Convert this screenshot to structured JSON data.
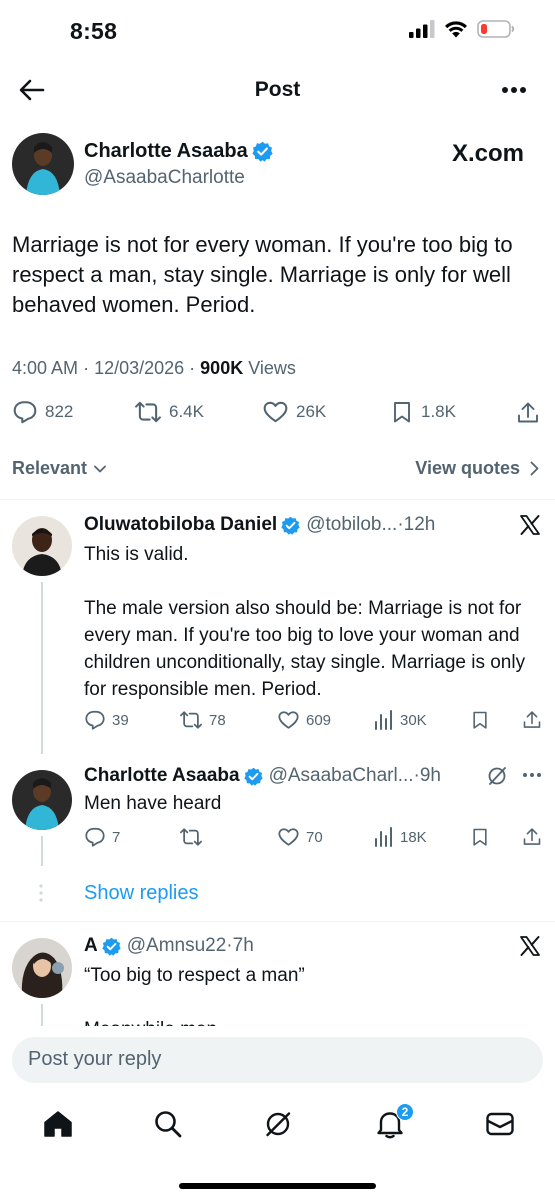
{
  "status": {
    "time": "8:58"
  },
  "nav": {
    "title": "Post"
  },
  "post": {
    "author": "Charlotte Asaaba",
    "handle": "@AsaabaCharlotte",
    "source": "X.com",
    "text": "Marriage is not for every woman. If you're too big to respect a man, stay single. Marriage is only for well behaved women. Period.",
    "time": "4:00 AM",
    "date": "12/03/2026",
    "views_count": "900K",
    "views_label": "Views",
    "replies": "822",
    "reposts": "6.4K",
    "likes": "26K",
    "bookmarks": "1.8K"
  },
  "filter": {
    "label": "Relevant",
    "view_quotes": "View quotes"
  },
  "replies": [
    {
      "author": "Oluwatobiloba Daniel",
      "handle": "@tobilob...",
      "time": "12h",
      "line1": "This is valid.",
      "line2": "The male version also should be: Marriage is not for every man. If you're too big to love your woman and children unconditionally, stay single. Marriage is only for responsible men. Period.",
      "replies": "39",
      "reposts": "78",
      "likes": "609",
      "views": "30K"
    },
    {
      "author": "Charlotte Asaaba",
      "handle": "@AsaabaCharl...",
      "time": "9h",
      "text": "Men have heard",
      "replies": "7",
      "reposts": "",
      "likes": "70",
      "views": "18K"
    },
    {
      "author": "A",
      "handle": "@Amnsu22",
      "time": "7h",
      "text": "“Too big to respect a man”",
      "cutoff": "Meanwhile men"
    }
  ],
  "show_replies": "Show replies",
  "reply_bar": {
    "placeholder": "Post your reply"
  },
  "tabbar": {
    "notifications_badge": "2"
  },
  "colors": {
    "accent": "#1d9bf0",
    "text": "#0f1419",
    "secondary": "#536471"
  }
}
